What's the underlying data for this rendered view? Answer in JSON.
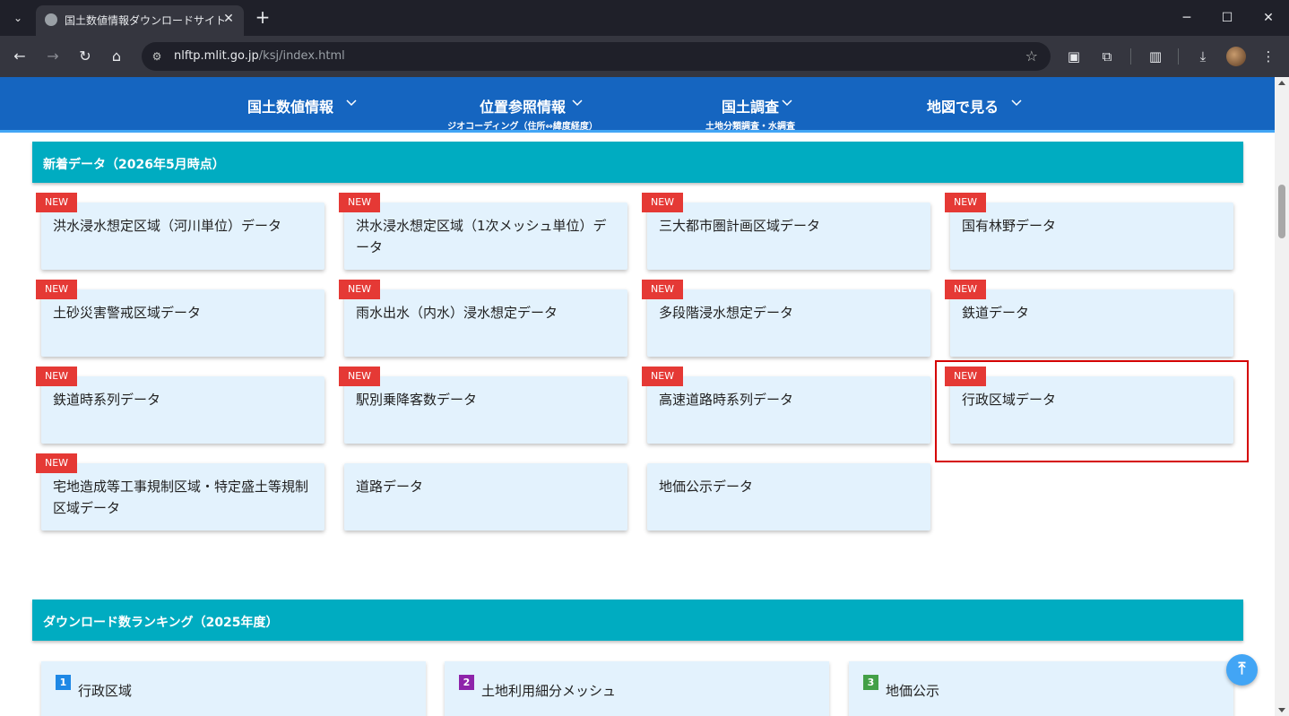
{
  "browser": {
    "tab_title": "国土数値情報ダウンロードサイト",
    "url_host": "nlftp.mlit.go.jp",
    "url_path": "/ksj/index.html"
  },
  "nav": {
    "items": [
      {
        "label": "国土数値情報",
        "sub": ""
      },
      {
        "label": "位置参照情報",
        "sub": "ジオコーディング（住所⇔緯度経度）"
      },
      {
        "label": "国土調査",
        "sub": "土地分類調査・水調査"
      },
      {
        "label": "地図で見る",
        "sub": ""
      }
    ]
  },
  "new_data": {
    "title": "新着データ（2026年5月時点）",
    "badge_label": "NEW",
    "cards": [
      {
        "label": "洪水浸水想定区域（河川単位）データ",
        "new": true
      },
      {
        "label": "洪水浸水想定区域（1次メッシュ単位）データ",
        "new": true
      },
      {
        "label": "三大都市圏計画区域データ",
        "new": true
      },
      {
        "label": "国有林野データ",
        "new": true
      },
      {
        "label": "土砂災害警戒区域データ",
        "new": true
      },
      {
        "label": "雨水出水（内水）浸水想定データ",
        "new": true
      },
      {
        "label": "多段階浸水想定データ",
        "new": true
      },
      {
        "label": "鉄道データ",
        "new": true
      },
      {
        "label": "鉄道時系列データ",
        "new": true
      },
      {
        "label": "駅別乗降客数データ",
        "new": true
      },
      {
        "label": "高速道路時系列データ",
        "new": true
      },
      {
        "label": "行政区域データ",
        "new": true
      },
      {
        "label": "宅地造成等工事規制区域・特定盛土等規制区域データ",
        "new": true
      },
      {
        "label": "道路データ",
        "new": false
      },
      {
        "label": "地価公示データ",
        "new": false
      }
    ]
  },
  "ranking": {
    "title": "ダウンロード数ランキング（2025年度）",
    "items": [
      {
        "rank": "1",
        "label": "行政区域",
        "color": "#1e88e5"
      },
      {
        "rank": "2",
        "label": "土地利用細分メッシュ",
        "color": "#8e24aa"
      },
      {
        "rank": "3",
        "label": "地価公示",
        "color": "#43a047"
      }
    ]
  },
  "to_top_icon": "arrow-up-icon"
}
